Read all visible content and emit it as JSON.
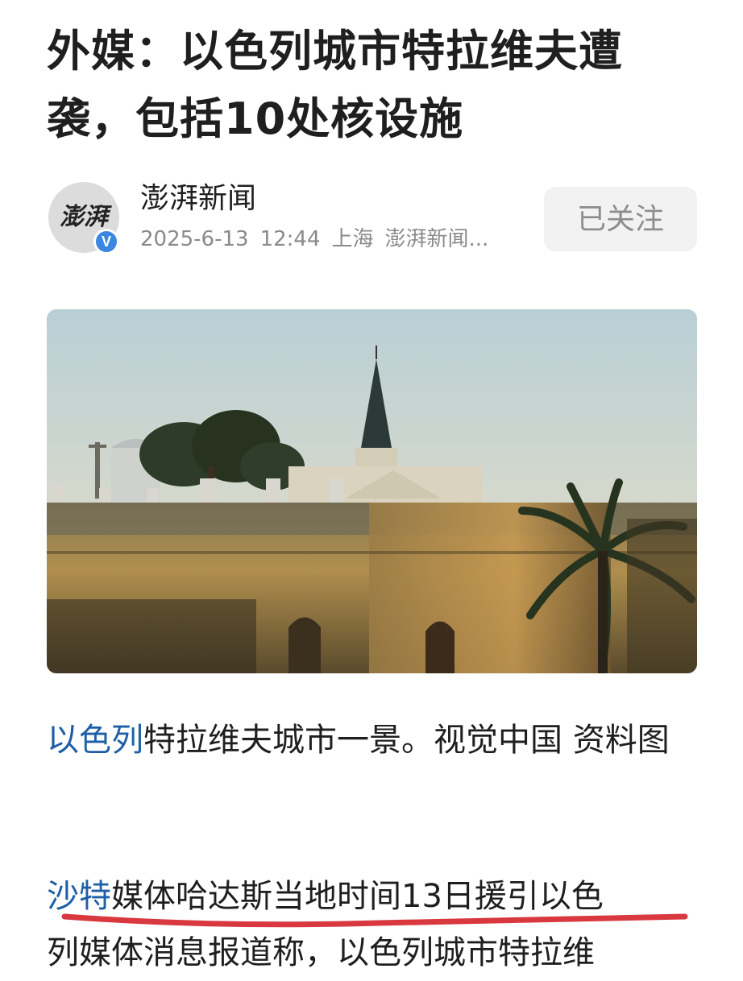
{
  "article": {
    "title": "外媒：以色列城市特拉维夫遭袭，包括10处核设施"
  },
  "author": {
    "name": "澎湃新闻",
    "avatar_text": "澎湃",
    "verified_badge": "V",
    "date": "2025-6-13",
    "time": "12:44",
    "location": "上海",
    "source": "澎湃新闻...",
    "follow_label": "已关注"
  },
  "image": {
    "caption_link": "以色列",
    "caption_text": "特拉维夫城市一景。视觉中国 资料图"
  },
  "body": {
    "para_link": "沙特",
    "para_line1": "媒体哈达斯当地时间13日援引以色",
    "para_line2": "列媒体消息报道称，以色列城市特拉维"
  },
  "colors": {
    "link": "#1e5fa8",
    "verified": "#3a86e0",
    "underline": "#d8383e"
  }
}
